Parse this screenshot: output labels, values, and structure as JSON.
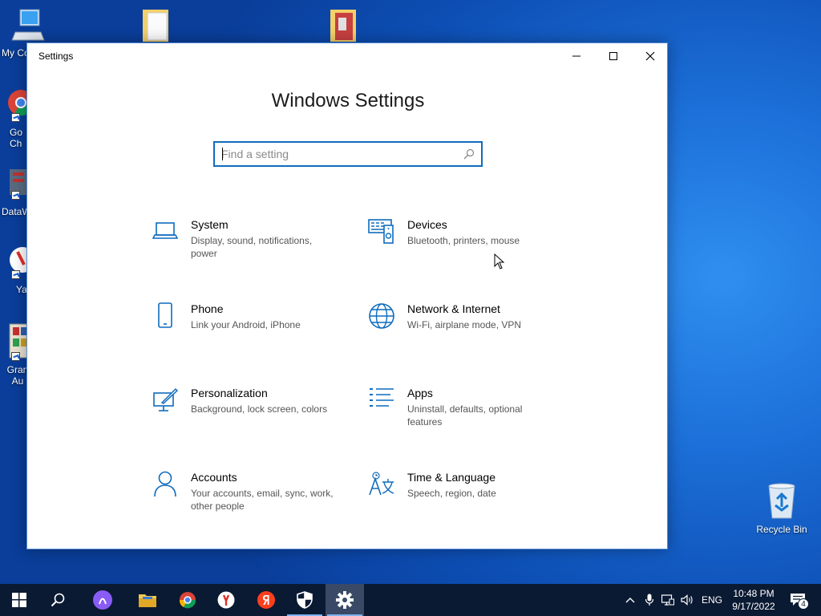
{
  "desktop": {
    "icons": [
      {
        "label": "My Co"
      },
      {
        "label": "Go Ch"
      },
      {
        "label": "DataW"
      },
      {
        "label": "Ya"
      },
      {
        "label": "Gran Au"
      }
    ],
    "recycle_bin": {
      "label": "Recycle Bin"
    }
  },
  "window": {
    "title": "Settings",
    "heading": "Windows Settings",
    "search": {
      "placeholder": "Find a setting",
      "value": ""
    },
    "tiles": [
      {
        "title": "System",
        "desc": "Display, sound, notifications, power",
        "icon": "laptop-icon"
      },
      {
        "title": "Devices",
        "desc": "Bluetooth, printers, mouse",
        "icon": "devices-icon"
      },
      {
        "title": "Phone",
        "desc": "Link your Android, iPhone",
        "icon": "phone-icon"
      },
      {
        "title": "Network & Internet",
        "desc": "Wi-Fi, airplane mode, VPN",
        "icon": "globe-icon"
      },
      {
        "title": "Personalization",
        "desc": "Background, lock screen, colors",
        "icon": "paint-icon"
      },
      {
        "title": "Apps",
        "desc": "Uninstall, defaults, optional features",
        "icon": "apps-list-icon"
      },
      {
        "title": "Accounts",
        "desc": "Your accounts, email, sync, work, other people",
        "icon": "person-icon"
      },
      {
        "title": "Time & Language",
        "desc": "Speech, region, date",
        "icon": "time-language-icon"
      }
    ]
  },
  "taskbar": {
    "language": "ENG",
    "time": "10:48 PM",
    "date": "9/17/2022",
    "notification_count": "4"
  },
  "colors": {
    "accent": "#0f6cbd",
    "taskbar": "#0b1a33",
    "desktop": "#1c6fd8"
  }
}
